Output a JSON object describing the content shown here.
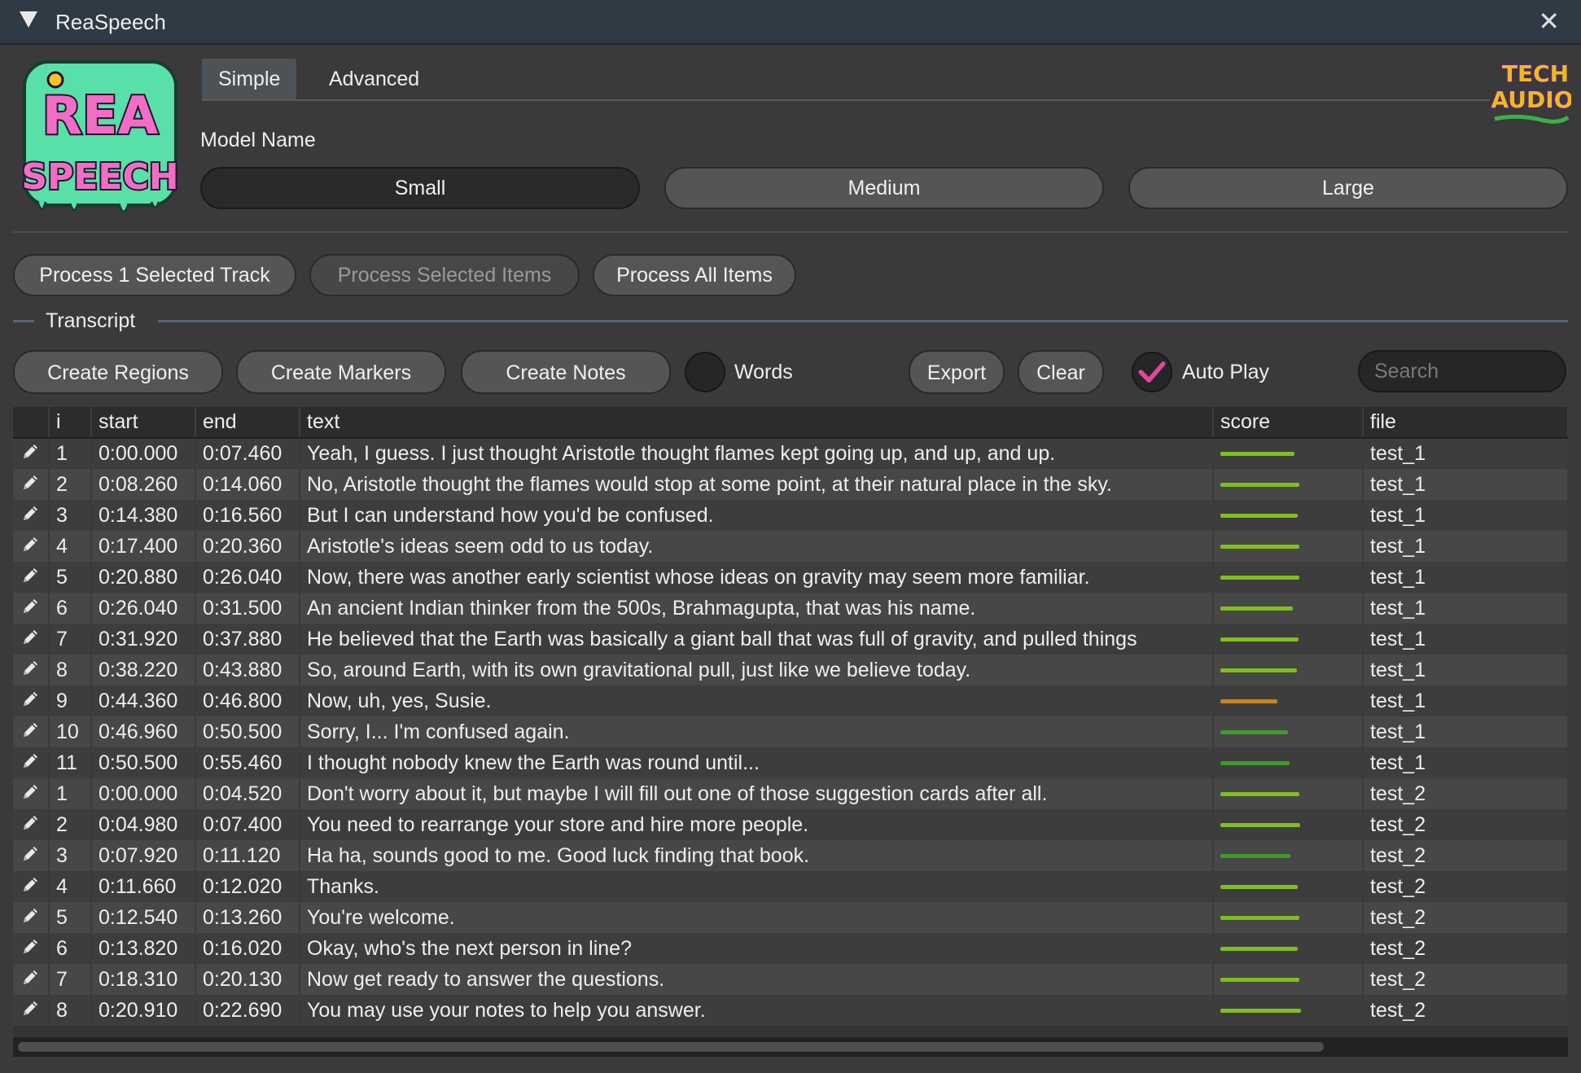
{
  "window": {
    "title": "ReaSpeech",
    "close_glyph": "✕"
  },
  "logo": {
    "text_line1": "REA",
    "text_line2": "SPEECH",
    "partner_text_line1": "TECH",
    "partner_text_line2": "AUDIO"
  },
  "tabs": [
    {
      "label": "Simple",
      "active": true
    },
    {
      "label": "Advanced",
      "active": false
    }
  ],
  "model": {
    "label": "Model Name",
    "options": [
      {
        "label": "Small",
        "selected": true
      },
      {
        "label": "Medium",
        "selected": false
      },
      {
        "label": "Large",
        "selected": false
      }
    ]
  },
  "process": {
    "selected_track": "Process 1 Selected Track",
    "selected_items": "Process  Selected Items",
    "all_items": "Process All Items"
  },
  "transcript": {
    "title": "Transcript",
    "create_regions": "Create Regions",
    "create_markers": "Create Markers",
    "create_notes": "Create Notes",
    "words_label": "Words",
    "words_checked": false,
    "export": "Export",
    "clear": "Clear",
    "autoplay_label": "Auto Play",
    "autoplay_checked": true,
    "search_placeholder": "Search"
  },
  "table": {
    "columns": [
      "",
      "i",
      "start",
      "end",
      "text",
      "score",
      "file"
    ],
    "rows": [
      {
        "i": "1",
        "start": "0:00.000",
        "end": "0:07.460",
        "text": "Yeah, I guess. I just thought Aristotle thought flames kept going up, and up, and up.",
        "score": 0.83,
        "score_color": "#7fbf1e",
        "file": "test_1"
      },
      {
        "i": "2",
        "start": "0:08.260",
        "end": "0:14.060",
        "text": "No, Aristotle thought the flames would stop at some point, at their natural place in the sky.",
        "score": 0.88,
        "score_color": "#7fbf1e",
        "file": "test_1"
      },
      {
        "i": "3",
        "start": "0:14.380",
        "end": "0:16.560",
        "text": "But I can understand how you'd be confused.",
        "score": 0.86,
        "score_color": "#7fbf1e",
        "file": "test_1"
      },
      {
        "i": "4",
        "start": "0:17.400",
        "end": "0:20.360",
        "text": "Aristotle's ideas seem odd to us today.",
        "score": 0.88,
        "score_color": "#7fbf1e",
        "file": "test_1"
      },
      {
        "i": "5",
        "start": "0:20.880",
        "end": "0:26.040",
        "text": "Now, there was another early scientist whose ideas on gravity may seem more familiar.",
        "score": 0.88,
        "score_color": "#7fbf1e",
        "file": "test_1"
      },
      {
        "i": "6",
        "start": "0:26.040",
        "end": "0:31.500",
        "text": "An ancient Indian thinker from the 500s, Brahmagupta, that was his name.",
        "score": 0.81,
        "score_color": "#7fbf1e",
        "file": "test_1"
      },
      {
        "i": "7",
        "start": "0:31.920",
        "end": "0:37.880",
        "text": "He believed that the Earth was basically a giant ball that was full of gravity, and pulled things",
        "score": 0.87,
        "score_color": "#7fbf1e",
        "file": "test_1"
      },
      {
        "i": "8",
        "start": "0:38.220",
        "end": "0:43.880",
        "text": "So, around Earth, with its own gravitational pull, just like we believe today.",
        "score": 0.85,
        "score_color": "#7fbf1e",
        "file": "test_1"
      },
      {
        "i": "9",
        "start": "0:44.360",
        "end": "0:46.800",
        "text": "Now, uh, yes, Susie.",
        "score": 0.64,
        "score_color": "#c8861e",
        "file": "test_1"
      },
      {
        "i": "10",
        "start": "0:46.960",
        "end": "0:50.500",
        "text": "Sorry, I... I'm confused again.",
        "score": 0.75,
        "score_color": "#3f9a2a",
        "file": "test_1"
      },
      {
        "i": "11",
        "start": "0:50.500",
        "end": "0:55.460",
        "text": "I thought nobody knew the Earth was round until...",
        "score": 0.77,
        "score_color": "#3f9a2a",
        "file": "test_1"
      },
      {
        "i": "1",
        "start": "0:00.000",
        "end": "0:04.520",
        "text": "Don't worry about it, but maybe I will fill out one of those suggestion cards after all.",
        "score": 0.88,
        "score_color": "#7fbf1e",
        "file": "test_2"
      },
      {
        "i": "2",
        "start": "0:04.980",
        "end": "0:07.400",
        "text": "You need to rearrange your store and hire more people.",
        "score": 0.89,
        "score_color": "#7fbf1e",
        "file": "test_2"
      },
      {
        "i": "3",
        "start": "0:07.920",
        "end": "0:11.120",
        "text": "Ha ha, sounds good to me. Good luck finding that book.",
        "score": 0.78,
        "score_color": "#3f9a2a",
        "file": "test_2"
      },
      {
        "i": "4",
        "start": "0:11.660",
        "end": "0:12.020",
        "text": "Thanks.",
        "score": 0.86,
        "score_color": "#7fbf1e",
        "file": "test_2"
      },
      {
        "i": "5",
        "start": "0:12.540",
        "end": "0:13.260",
        "text": "You're welcome.",
        "score": 0.88,
        "score_color": "#7fbf1e",
        "file": "test_2"
      },
      {
        "i": "6",
        "start": "0:13.820",
        "end": "0:16.020",
        "text": "Okay, who's the next person in line?",
        "score": 0.86,
        "score_color": "#7fbf1e",
        "file": "test_2"
      },
      {
        "i": "7",
        "start": "0:18.310",
        "end": "0:20.130",
        "text": "Now get ready to answer the questions.",
        "score": 0.88,
        "score_color": "#7fbf1e",
        "file": "test_2"
      },
      {
        "i": "8",
        "start": "0:20.910",
        "end": "0:22.690",
        "text": "You may use your notes to help you answer.",
        "score": 0.9,
        "score_color": "#7fbf1e",
        "file": "test_2"
      }
    ]
  },
  "colors": {
    "accent_check": "#e0479a",
    "score_good": "#7fbf1e",
    "score_mid": "#3f9a2a",
    "score_low": "#c8861e"
  }
}
